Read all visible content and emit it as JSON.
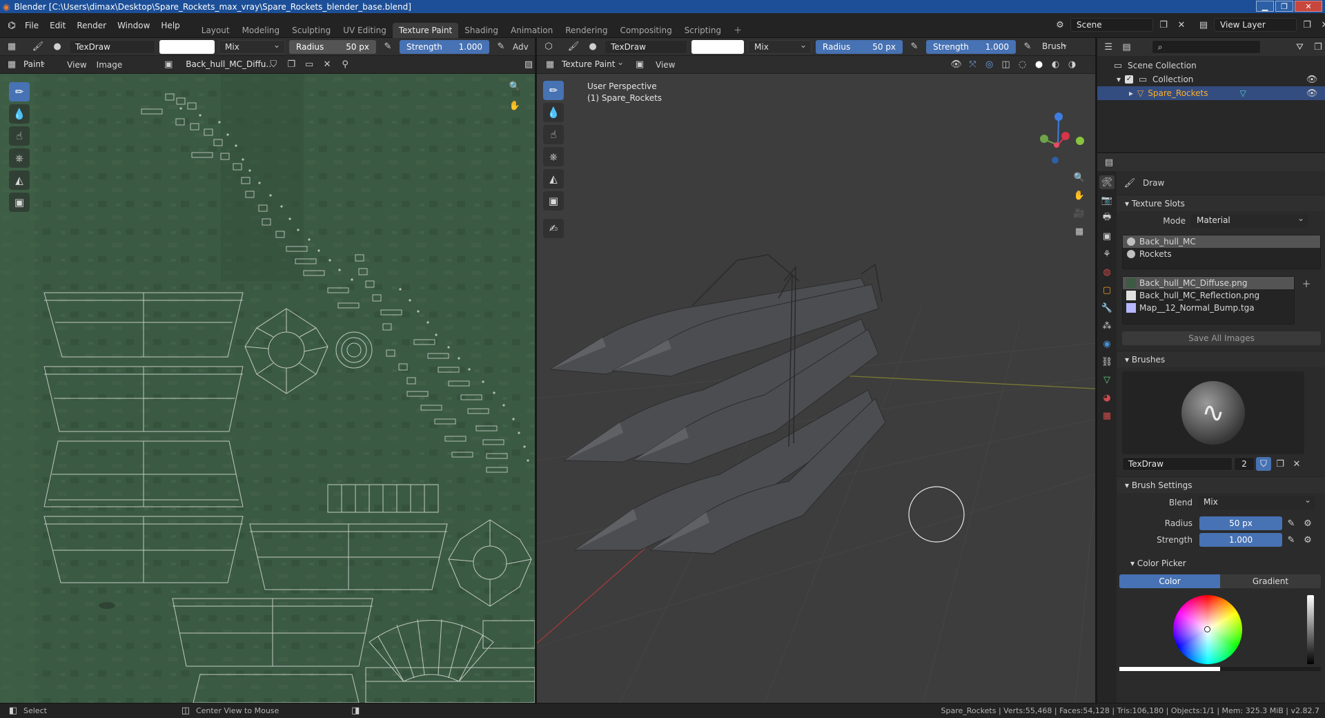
{
  "title": "Blender [C:\\Users\\dimax\\Desktop\\Spare_Rockets_max_vray\\Spare_Rockets_blender_base.blend]",
  "menus": [
    "File",
    "Edit",
    "Render",
    "Window",
    "Help"
  ],
  "workspaces": [
    "Layout",
    "Modeling",
    "Sculpting",
    "UV Editing",
    "Texture Paint",
    "Shading",
    "Animation",
    "Rendering",
    "Compositing",
    "Scripting"
  ],
  "active_workspace": "Texture Paint",
  "scene": "Scene",
  "view_layer": "View Layer",
  "left": {
    "brush": "TexDraw",
    "blend": "Mix",
    "radius_label": "Radius",
    "radius_value": "50 px",
    "strength_label": "Strength",
    "strength_value": "1.000",
    "adv": "Adv",
    "mode": "Paint",
    "view": "View",
    "image": "Image",
    "image_name": "Back_hull_MC_Diffu.."
  },
  "right": {
    "brush": "TexDraw",
    "blend": "Mix",
    "radius_label": "Radius",
    "radius_value": "50 px",
    "strength_label": "Strength",
    "strength_value": "1.000",
    "brush_menu": "Brush",
    "mode": "Texture Paint",
    "view": "View",
    "overlay1": "User Perspective",
    "overlay2": "(1) Spare_Rockets"
  },
  "outliner": {
    "root": "Scene Collection",
    "collection": "Collection",
    "object": "Spare_Rockets"
  },
  "props": {
    "tool": "Draw",
    "texture_slots": "Texture Slots",
    "mode_label": "Mode",
    "mode_value": "Material",
    "materials": [
      "Back_hull_MC",
      "Rockets"
    ],
    "images": [
      "Back_hull_MC_Diffuse.png",
      "Back_hull_MC_Reflection.png",
      "Map__12_Normal_Bump.tga"
    ],
    "save_all": "Save All Images",
    "brushes": "Brushes",
    "brush_name": "TexDraw",
    "brush_users": "2",
    "brush_settings": "Brush Settings",
    "blend_label": "Blend",
    "blend_value": "Mix",
    "radius_label": "Radius",
    "radius_value": "50 px",
    "strength_label": "Strength",
    "strength_value": "1.000",
    "color_picker": "Color Picker",
    "color_tab": "Color",
    "gradient_tab": "Gradient"
  },
  "status": {
    "select": "Select",
    "center": "Center View to Mouse",
    "stats": "Spare_Rockets | Verts:55,468 | Faces:54,128 | Tris:106,180 | Objects:1/1 | Mem: 325.3 MiB | v2.82.7"
  },
  "colors": {
    "accent": "#4772b3",
    "title_bar": "#1c4f97",
    "uv_bg": "#3b5a43",
    "viewport_bg": "#3d3d3d",
    "selected_object": "#ffaf29"
  }
}
